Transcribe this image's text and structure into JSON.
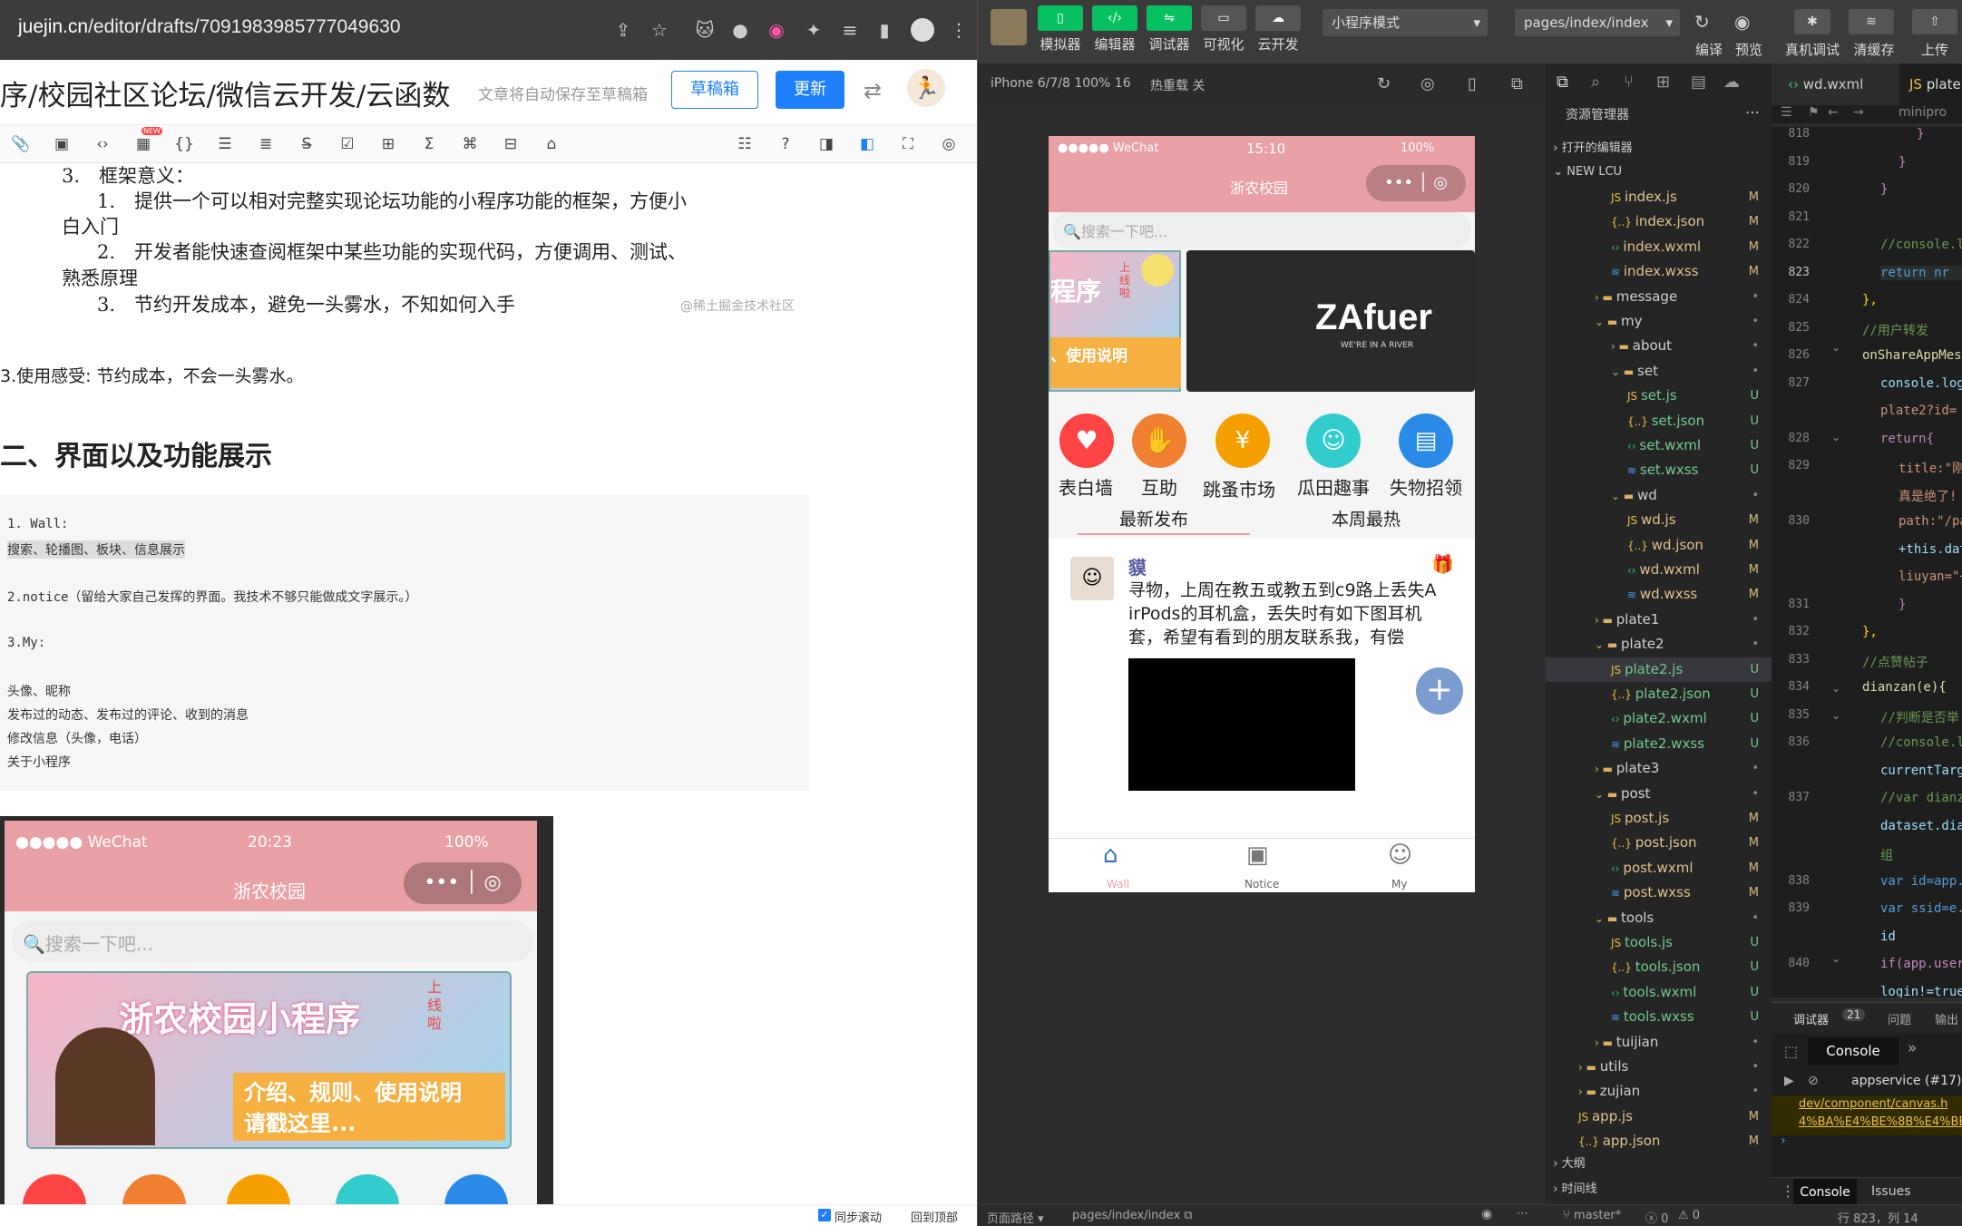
{
  "browser": {
    "domain": "juejin.cn",
    "path": "/editor/drafts/7091983985777049630"
  },
  "editor_header": {
    "title": "序/校园社区论坛/微信云开发/云函数",
    "autosave_hint": "文章将自动保存至草稿箱",
    "drafts_button": "草稿箱",
    "update_button": "更新"
  },
  "toolbar": {
    "new_badge": "NEW"
  },
  "doc": {
    "heading3": "3.　框架意义：",
    "item1a": "1.　提供一个可以相对完整实现论坛功能的小程序功能的框架，方便小",
    "item1b": "白入门",
    "item2a": "2.　开发者能快速查阅框架中某些功能的实现代码，方便调用、测试、",
    "item2b": "熟悉原理",
    "item3": "3.　节约开发成本，避免一头雾水，不知如何入手",
    "watermark": "@稀土掘金技术社区",
    "feeling": "3.使用感受:  节约成本，不会一头雾水。",
    "h2": "二、界面以及功能展示",
    "code": [
      "1. Wall:",
      "搜索、轮播图、板块、信息展示",
      "",
      "2.notice（留给大家自己发挥的界面。我技术不够只能做成文字展示。）",
      "",
      "3.My:",
      "",
      "头像、昵称",
      "发布过的动态、发布过的评论、收到的消息",
      "修改信息（头像，电话）",
      "关于小程序"
    ]
  },
  "doc_phone": {
    "carrier": "●●●●● WeChat",
    "time": "20:23",
    "battery": "100%",
    "title": "浙农校园",
    "search": "搜索一下吧...",
    "banner_text1": "浙农校园小程序",
    "banner_text2": "介绍、规则、使用说明",
    "banner_text3": "请戳这里...",
    "banner_tag": "上线啦"
  },
  "left_status": {
    "sync_scroll": "同步滚动",
    "back_top": "回到顶部"
  },
  "devtools": {
    "buttons": [
      "模拟器",
      "编辑器",
      "调试器",
      "可视化",
      "云开发"
    ],
    "mode": "小程序模式",
    "page": "pages/index/index",
    "right_buttons": [
      "编译",
      "预览",
      "真机调试",
      "清缓存",
      "上传"
    ],
    "device": "iPhone 6/7/8 100% 16",
    "hot_reload": "热重载 关"
  },
  "sim": {
    "carrier": "●●●●● WeChat",
    "time": "15:10",
    "battery": "100%",
    "title": "浙农校园",
    "search": "搜索一下吧...",
    "brand": "ZAfuer",
    "brand_sub": "WE'RE IN A RIVER",
    "banner_left1": "程序",
    "banner_left2": "、使用说明",
    "banner_tag": "上线啦",
    "categories": [
      "表白墙",
      "互助",
      "跳蚤市场",
      "瓜田趣事",
      "失物招领"
    ],
    "tabs": [
      "最新发布",
      "本周最热"
    ],
    "post_user": "貘",
    "post_text": [
      "寻物，上周在教五或教五到c9路上丢失A",
      "irPods的耳机盒，丢失时有如下图耳机",
      "套，希望有看到的朋友联系我，有偿"
    ],
    "nav": [
      "Wall",
      "Notice",
      "My"
    ]
  },
  "explorer": {
    "header": "资源管理器",
    "open_editors": "打开的编辑器",
    "project": "NEW LCU",
    "items": [
      {
        "name": "index.js",
        "type": "js",
        "indent": 3,
        "status": "M"
      },
      {
        "name": "index.json",
        "type": "json",
        "indent": 3,
        "status": "M"
      },
      {
        "name": "index.wxml",
        "type": "wxml",
        "indent": 3,
        "status": "M"
      },
      {
        "name": "index.wxss",
        "type": "wxss",
        "indent": 3,
        "status": "M"
      },
      {
        "name": "message",
        "type": "folder-c",
        "indent": 2,
        "status": "•"
      },
      {
        "name": "my",
        "type": "folder-o",
        "indent": 2,
        "status": "•"
      },
      {
        "name": "about",
        "type": "folder-c",
        "indent": 3,
        "status": "•"
      },
      {
        "name": "set",
        "type": "folder-o",
        "indent": 3,
        "status": "•"
      },
      {
        "name": "set.js",
        "type": "js",
        "indent": 4,
        "status": "U"
      },
      {
        "name": "set.json",
        "type": "json",
        "indent": 4,
        "status": "U"
      },
      {
        "name": "set.wxml",
        "type": "wxml",
        "indent": 4,
        "status": "U"
      },
      {
        "name": "set.wxss",
        "type": "wxss",
        "indent": 4,
        "status": "U"
      },
      {
        "name": "wd",
        "type": "folder-o",
        "indent": 3,
        "status": "•"
      },
      {
        "name": "wd.js",
        "type": "js",
        "indent": 4,
        "status": "M"
      },
      {
        "name": "wd.json",
        "type": "json",
        "indent": 4,
        "status": "M"
      },
      {
        "name": "wd.wxml",
        "type": "wxml",
        "indent": 4,
        "status": "M"
      },
      {
        "name": "wd.wxss",
        "type": "wxss",
        "indent": 4,
        "status": "M"
      },
      {
        "name": "plate1",
        "type": "folder-c",
        "indent": 2,
        "status": "•"
      },
      {
        "name": "plate2",
        "type": "folder-o",
        "indent": 2,
        "status": "•"
      },
      {
        "name": "plate2.js",
        "type": "js",
        "indent": 3,
        "status": "U",
        "selected": true
      },
      {
        "name": "plate2.json",
        "type": "json",
        "indent": 3,
        "status": "U"
      },
      {
        "name": "plate2.wxml",
        "type": "wxml",
        "indent": 3,
        "status": "U"
      },
      {
        "name": "plate2.wxss",
        "type": "wxss",
        "indent": 3,
        "status": "U"
      },
      {
        "name": "plate3",
        "type": "folder-c",
        "indent": 2,
        "status": "•"
      },
      {
        "name": "post",
        "type": "folder-o",
        "indent": 2,
        "status": "•"
      },
      {
        "name": "post.js",
        "type": "js",
        "indent": 3,
        "status": "M"
      },
      {
        "name": "post.json",
        "type": "json",
        "indent": 3,
        "status": "M"
      },
      {
        "name": "post.wxml",
        "type": "wxml",
        "indent": 3,
        "status": "M"
      },
      {
        "name": "post.wxss",
        "type": "wxss",
        "indent": 3,
        "status": "M"
      },
      {
        "name": "tools",
        "type": "folder-o",
        "indent": 2,
        "status": "•"
      },
      {
        "name": "tools.js",
        "type": "js",
        "indent": 3,
        "status": "U"
      },
      {
        "name": "tools.json",
        "type": "json",
        "indent": 3,
        "status": "U"
      },
      {
        "name": "tools.wxml",
        "type": "wxml",
        "indent": 3,
        "status": "U"
      },
      {
        "name": "tools.wxss",
        "type": "wxss",
        "indent": 3,
        "status": "U"
      },
      {
        "name": "tuijian",
        "type": "folder-c",
        "indent": 2,
        "status": "•"
      },
      {
        "name": "utils",
        "type": "folder-c",
        "indent": 1,
        "status": "•"
      },
      {
        "name": "zujian",
        "type": "folder-c",
        "indent": 1,
        "status": "•"
      },
      {
        "name": "app.js",
        "type": "js",
        "indent": 1,
        "status": "M"
      },
      {
        "name": "app.json",
        "type": "json",
        "indent": 1,
        "status": "M"
      }
    ],
    "outline": "大纲",
    "timeline": "时间线"
  },
  "editor": {
    "tabs": [
      "wd.wxml",
      "plate"
    ],
    "breadcrumb": "minipro",
    "lines": [
      {
        "n": "818",
        "code": "}",
        "color": "#c586c0",
        "ind": 60
      },
      {
        "n": "819",
        "code": "}",
        "color": "#c586c0",
        "ind": 40
      },
      {
        "n": "820",
        "code": "}",
        "color": "#c586c0",
        "ind": 20
      },
      {
        "n": "821",
        "code": "",
        "color": "#ccc",
        "ind": 0
      },
      {
        "n": "822",
        "code": "//console.l",
        "color": "#6a9955",
        "ind": 20
      },
      {
        "n": "823",
        "code": "return nr",
        "color": "#569cd6",
        "ind": 20
      },
      {
        "n": "824",
        "code": "},",
        "color": "#ffd700",
        "ind": 0
      },
      {
        "n": "825",
        "code": "//用户转发",
        "color": "#6a9955",
        "ind": 0
      },
      {
        "n": "826",
        "code": "onShareAppMes",
        "color": "#dcdcaa",
        "ind": 0
      },
      {
        "n": "827",
        "code": "console.log",
        "color": "#9cdcfe",
        "ind": 20
      },
      {
        "n": "",
        "code": "plate2?id=",
        "color": "#ce9178",
        "ind": 20
      },
      {
        "n": "828",
        "code": "return{",
        "color": "#c586c0",
        "ind": 20
      },
      {
        "n": "829",
        "code": "title:\"刚",
        "color": "#ce9178",
        "ind": 40
      },
      {
        "n": "",
        "code": "真是绝了!",
        "color": "#ce9178",
        "ind": 40
      },
      {
        "n": "830",
        "code": "path:\"/pa",
        "color": "#ce9178",
        "ind": 40
      },
      {
        "n": "",
        "code": "+this.dat",
        "color": "#9cdcfe",
        "ind": 40
      },
      {
        "n": "",
        "code": "liuyan=\"+",
        "color": "#ce9178",
        "ind": 40
      },
      {
        "n": "831",
        "code": "}",
        "color": "#c586c0",
        "ind": 40
      },
      {
        "n": "832",
        "code": "},",
        "color": "#ffd700",
        "ind": 0
      },
      {
        "n": "833",
        "code": "//点赞帖子",
        "color": "#6a9955",
        "ind": 0
      },
      {
        "n": "834",
        "code": "dianzan(e){",
        "color": "#dcdcaa",
        "ind": 0
      },
      {
        "n": "835",
        "code": "//判断是否举",
        "color": "#6a9955",
        "ind": 20
      },
      {
        "n": "836",
        "code": "//console.l",
        "color": "#6a9955",
        "ind": 20
      },
      {
        "n": "",
        "code": "currentTarg",
        "color": "#9cdcfe",
        "ind": 20
      },
      {
        "n": "837",
        "code": "//var dianz",
        "color": "#6a9955",
        "ind": 20
      },
      {
        "n": "",
        "code": "dataset.dia",
        "color": "#9cdcfe",
        "ind": 20
      },
      {
        "n": "",
        "code": "组",
        "color": "#6a9955",
        "ind": 20
      },
      {
        "n": "838",
        "code": "var id=app.",
        "color": "#569cd6",
        "ind": 20
      },
      {
        "n": "839",
        "code": "var ssid=e.",
        "color": "#569cd6",
        "ind": 20
      },
      {
        "n": "",
        "code": "id",
        "color": "#9cdcfe",
        "ind": 20
      },
      {
        "n": "840",
        "code": "if(app.user",
        "color": "#c586c0",
        "ind": 20
      },
      {
        "n": "",
        "code": "login!=true",
        "color": "#9cdcfe",
        "ind": 20
      }
    ]
  },
  "console": {
    "tabs": [
      "调试器",
      "21",
      "问题",
      "输出"
    ],
    "console_tab": "Console",
    "context": "appservice (#17)",
    "link1": "dev/component/canvas.h",
    "link2": "4%BA%E4%BE%8B%E4%BB%A3",
    "bottom_tabs": [
      "Console",
      "Issues"
    ]
  },
  "bottom": {
    "path_label": "页面路径",
    "path": "pages/index/index",
    "branch": "master*",
    "errors": "0",
    "warnings": "0",
    "cursor": "行 823，列 14"
  },
  "colors": {
    "accent": "#1e80ff",
    "wechat_green": "#07c160",
    "nav_pink": "#e8a0a5"
  }
}
